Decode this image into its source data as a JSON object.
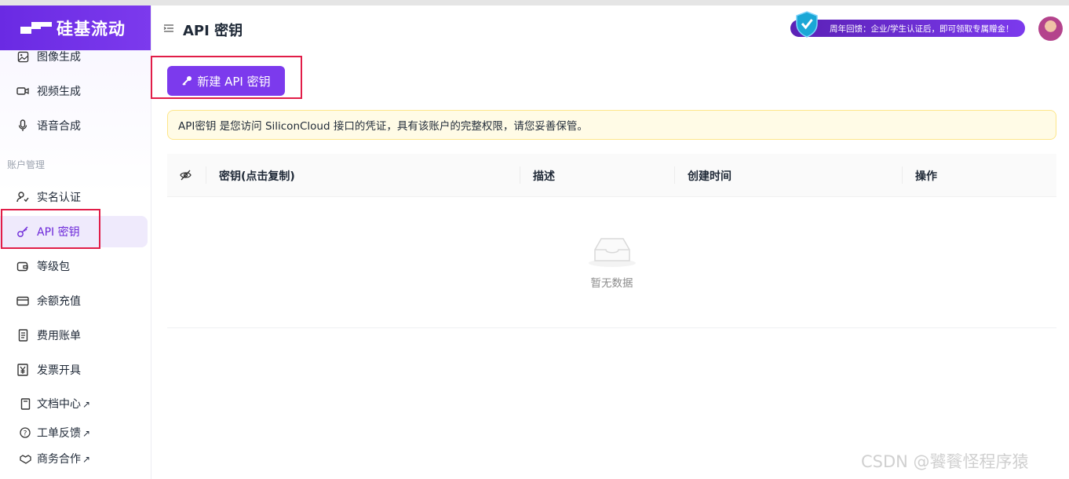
{
  "app": {
    "name": "硅基流动"
  },
  "header": {
    "title": "API 密钥",
    "promo": "周年回馈：企业/学生认证后，即可领取专属赠金！"
  },
  "sidebar": {
    "items_top": [
      {
        "label": "图像生成",
        "icon": "image-icon"
      },
      {
        "label": "视频生成",
        "icon": "video-icon"
      },
      {
        "label": "语音合成",
        "icon": "microphone-icon"
      }
    ],
    "section_label": "账户管理",
    "items_account": [
      {
        "label": "实名认证",
        "icon": "user-check-icon"
      },
      {
        "label": "API 密钥",
        "icon": "key-icon",
        "active": true
      },
      {
        "label": "等级包",
        "icon": "wallet-icon"
      },
      {
        "label": "余额充值",
        "icon": "credit-card-icon"
      },
      {
        "label": "费用账单",
        "icon": "receipt-icon"
      },
      {
        "label": "发票开具",
        "icon": "yen-icon"
      }
    ],
    "items_bottom": [
      {
        "label": "文档中心",
        "icon": "book-icon",
        "ext": "↗"
      },
      {
        "label": "工单反馈",
        "icon": "help-icon",
        "ext": "↗"
      },
      {
        "label": "商务合作",
        "icon": "handshake-icon",
        "ext": "↗"
      }
    ]
  },
  "main": {
    "create_button": "新建 API 密钥",
    "notice": "API密钥 是您访问 SiliconCloud 接口的凭证，具有该账户的完整权限，请您妥善保管。",
    "table": {
      "columns": [
        "密钥(点击复制)",
        "描述",
        "创建时间",
        "操作"
      ],
      "empty_text": "暂无数据"
    }
  },
  "watermark": "CSDN @饕餮怪程序猿",
  "colors": {
    "accent": "#7c3aed",
    "highlight": "#e11d48",
    "notice_bg": "#fffbe6"
  }
}
